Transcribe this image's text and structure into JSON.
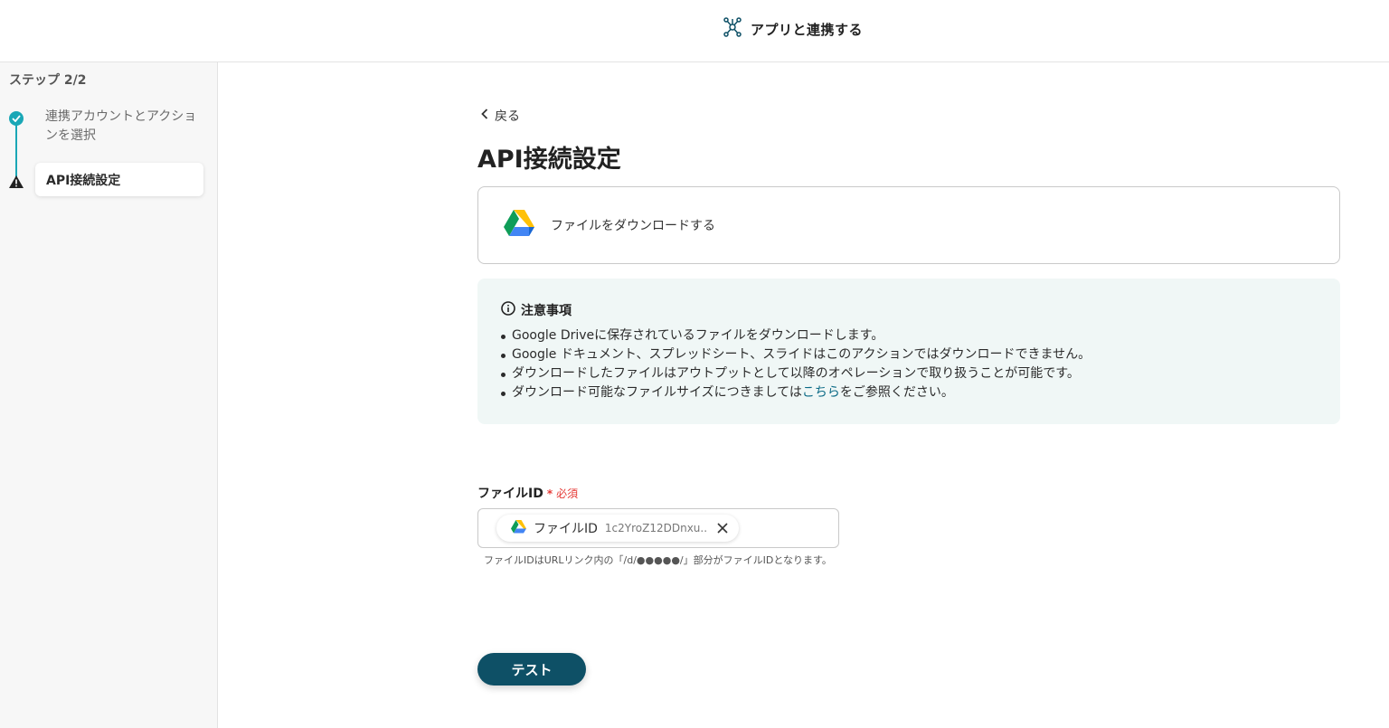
{
  "header": {
    "title": "アプリと連携する",
    "icon": "hub-icon",
    "accent": "#0e5066"
  },
  "sidebar": {
    "step_count": "ステップ 2/2",
    "steps": [
      {
        "label": "連携アカウントとアクションを選択",
        "status": "done",
        "icon": "check-circle-icon"
      },
      {
        "label": "API接続設定",
        "status": "current",
        "icon": "warning-icon"
      }
    ],
    "accent": "#1aa7b6"
  },
  "main": {
    "back_label": "戻る",
    "title": "API接続設定",
    "action": {
      "app_icon": "google-drive-icon",
      "label": "ファイルをダウンロードする"
    },
    "notice": {
      "title": "注意事項",
      "items": [
        "Google Driveに保存されているファイルをダウンロードします。",
        "Google ドキュメント、スプレッドシート、スライドはこのアクションではダウンロードできません。",
        "ダウンロードしたファイルはアウトプットとして以降のオペレーションで取り扱うことが可能です。"
      ],
      "last_item": {
        "prefix": "ダウンロード可能なファイルサイズにつきましては",
        "link": "こちら",
        "suffix": "をご参照ください。"
      },
      "background": "#f0f7f6"
    },
    "file_field": {
      "label": "ファイルID",
      "required_star": "*",
      "required_text": "必須",
      "chip_label": "ファイルID",
      "chip_value": "1c2YroZ12DDnxu...",
      "help": "ファイルIDはURLリンク内の「/d/●●●●●/」部分がファイルIDとなります。"
    },
    "test_button": "テスト",
    "button_color": "#0e5066",
    "required_color": "#e53935"
  }
}
